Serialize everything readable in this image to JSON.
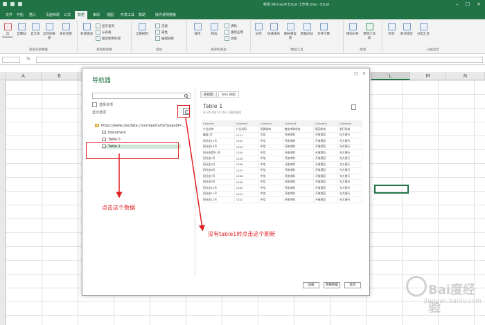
{
  "titlebar": {
    "title": "新建 Microsoft Excel 工作表.xlsx - Excel"
  },
  "tabs": [
    "文件",
    "开始",
    "插入",
    "页面布局",
    "公式",
    "数据",
    "审阅",
    "视图",
    "开发工具",
    "帮助",
    "操作说明搜索"
  ],
  "active_tab": "数据",
  "ribbon": {
    "groups": [
      {
        "label": "获取外部数据"
      },
      {
        "label": "获取和转换"
      },
      {
        "label": "连接"
      },
      {
        "label": "排序和筛选"
      },
      {
        "label": "数据工具"
      },
      {
        "label": "预测"
      },
      {
        "label": "分级显示"
      }
    ],
    "buttons": [
      "自 Access",
      "自网站",
      "自文本",
      "自其他来源",
      "现有连接",
      "新建查询",
      "全部刷新",
      "排序",
      "筛选",
      "分列",
      "快速填充",
      "删除重复值",
      "数据验证",
      "合并计算",
      "模拟分析",
      "预测工作表",
      "组合",
      "取消组合",
      "分类汇总"
    ],
    "small": [
      "显示查询",
      "从表格",
      "最近使用的源",
      "连接",
      "属性",
      "编辑链接",
      "清除",
      "重新应用",
      "高级"
    ]
  },
  "grid": {
    "columns_left": [
      "A",
      "B"
    ],
    "columns_right": [
      "L",
      "M",
      "N"
    ],
    "selected_column": "L"
  },
  "dialog": {
    "title": "导航器",
    "checkbox_label": "选择多项",
    "show_options": "显示选项",
    "tree": {
      "root": "https://www.ceicdata.com/reports/fx/?pageId=...",
      "items": [
        "Document",
        "Table 0",
        "Table 1"
      ],
      "selected": "Table 1"
    },
    "preview_tabs": [
      "表视图",
      "Web 视图"
    ],
    "preview_title": "Table 1",
    "preview_note": "在 2019年1月16日下载的预览",
    "table": {
      "headers": [
        "Column1",
        "Column2",
        "Column3",
        "Column4",
        "Column5",
        "Column6"
      ],
      "rows": [
        [
          "产品名称",
          "产品代码",
          "所属机构",
          "基金申购状态",
          "赎回状态",
          "发行机构"
        ],
        [
          "鑫益1号",
          "1111",
          "华夏",
          "开放申购",
          "开放赎回",
          "光大银行"
        ],
        [
          "阳光金13号",
          "1232",
          "中信",
          "开放申购",
          "开放赎回",
          "光大银行"
        ],
        [
          "阳光金18号",
          "1233",
          "中信",
          "开放申购",
          "开放赎回",
          "光大银行"
        ],
        [
          "阳光金提升1号",
          "1234",
          "中信",
          "开放申购",
          "开放赎回",
          "光大银行"
        ],
        [
          "阳光金2号",
          "1235",
          "中信",
          "开放申购",
          "开放赎回",
          "光大银行"
        ],
        [
          "阳光金3号",
          "1236",
          "中信",
          "开放申购",
          "开放赎回",
          "光大银行"
        ],
        [
          "阳光金6号",
          "1237",
          "中信",
          "开放申购",
          "开放赎回",
          "光大银行"
        ],
        [
          "阳光金7号",
          "1238",
          "中信",
          "开放申购",
          "开放赎回",
          "光大银行"
        ],
        [
          "阳光金9号",
          "1239",
          "中信",
          "开放申购",
          "开放赎回",
          "光大银行"
        ],
        [
          "阳光金10号",
          "1240",
          "中信",
          "开放申购",
          "开放赎回",
          "光大银行"
        ],
        [
          "阳光金11号",
          "1241",
          "中信",
          "开放申购",
          "开放赎回",
          "光大银行"
        ],
        [
          "阳光金12号",
          "1242",
          "中信",
          "开放申购",
          "开放赎回",
          "光大银行"
        ]
      ]
    },
    "buttons": {
      "load": "加载",
      "edit": "转换数据",
      "cancel": "取消"
    }
  },
  "annotations": {
    "click_data": "点击这个数据",
    "refresh_hint": "没有table1时点击这个刷新"
  },
  "watermark": {
    "text": "Bai度经验",
    "sub": "jingyan.baidu.com"
  },
  "colors": {
    "excel_green": "#217346",
    "annotation_red": "#e02020"
  }
}
